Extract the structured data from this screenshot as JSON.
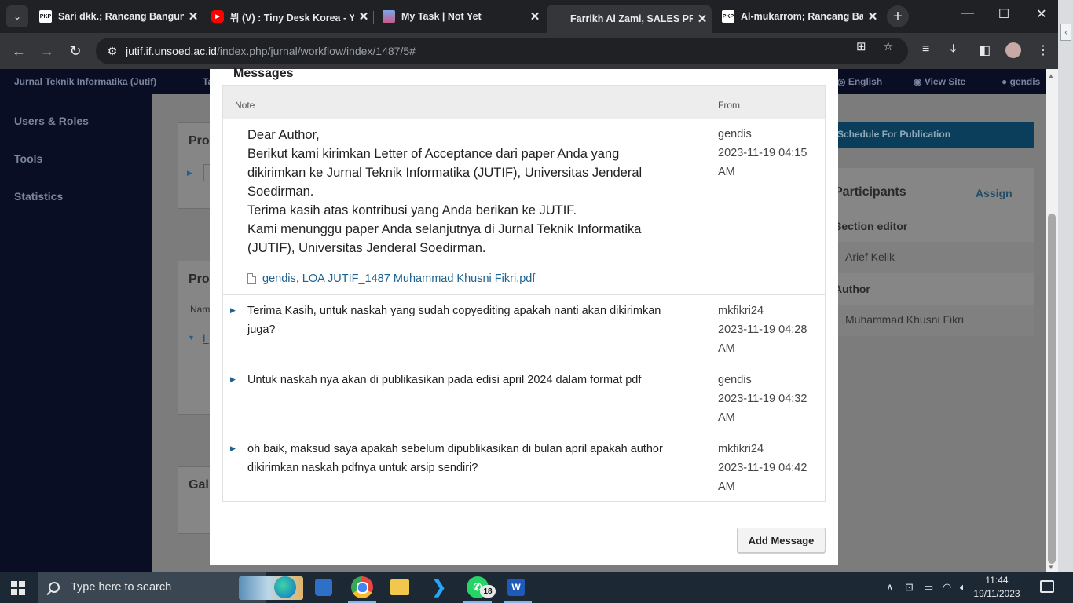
{
  "browser": {
    "tabs": [
      {
        "favicon": "PKP",
        "title": "Sari dkk.; Rancang Bangun",
        "close": "✕"
      },
      {
        "favicon": "▶",
        "title": "뷔 (V) : Tiny Desk Korea - Y",
        "close": "✕"
      },
      {
        "favicon": "",
        "title": "My Task | Not Yet",
        "close": "✕"
      },
      {
        "favicon": "",
        "title": "Farrikh Al Zami, SALES PRE",
        "close": "✕"
      },
      {
        "favicon": "PKP",
        "title": "Al-mukarrom; Rancang Ban",
        "close": "✕"
      }
    ],
    "url_host": "jutif.if.unsoed.ac.id",
    "url_path": "/index.php/jurnal/workflow/index/1487/5#"
  },
  "ojs": {
    "site_title": "Jurnal Teknik Informatika (Jutif)",
    "header_partial": "Ta",
    "language": "English",
    "view_site": "View Site",
    "user": "gendis",
    "sidebar": [
      "Users & Roles",
      "Tools",
      "Statistics"
    ],
    "panel_partials": [
      "Pro",
      "Pro",
      "Gal"
    ],
    "panel_name_partial": "Nam",
    "panel_link_partial": "L",
    "schedule_button": "Schedule For Publication",
    "participants": {
      "title": "Participants",
      "assign": "Assign",
      "groups": [
        {
          "label": "Section editor",
          "name": "Arief Kelik"
        },
        {
          "label": "Author",
          "name": "Muhammad Khusni Fikri"
        }
      ]
    }
  },
  "modal": {
    "title": "Messages",
    "col_note": "Note",
    "col_from": "From",
    "messages": [
      {
        "lines": [
          "Dear Author,",
          "Berikut kami kirimkan Letter of Acceptance dari paper Anda yang",
          "dikirimkan ke Jurnal Teknik Informatika (JUTIF), Universitas Jenderal",
          "Soedirman.",
          "Terima kasih atas kontribusi yang Anda berikan ke JUTIF.",
          "Kami menunggu paper Anda selanjutnya di Jurnal Teknik Informatika",
          "(JUTIF), Universitas Jenderal Soedirman."
        ],
        "attachment": "gendis, LOA JUTIF_1487 Muhammad Khusni Fikri.pdf",
        "from": "gendis",
        "date": "2023-11-19 04:15",
        "ampm": "AM"
      },
      {
        "text": "Terima Kasih, untuk naskah yang sudah copyediting apakah nanti akan dikirimkan juga?",
        "from": "mkfikri24",
        "date": "2023-11-19 04:28",
        "ampm": "AM"
      },
      {
        "text": "Untuk naskah nya akan di publikasikan pada edisi april 2024 dalam format pdf",
        "from": "gendis",
        "date": "2023-11-19 04:32",
        "ampm": "AM"
      },
      {
        "text": "oh baik, maksud saya apakah sebelum dipublikasikan di bulan april apakah author dikirimkan naskah pdfnya untuk arsip sendiri?",
        "from": "mkfikri24",
        "date": "2023-11-19 04:42",
        "ampm": "AM"
      }
    ],
    "add_button": "Add Message"
  },
  "taskbar": {
    "search_placeholder": "Type here to search",
    "whatsapp_badge": "18",
    "time": "11:44",
    "date": "19/11/2023"
  },
  "colors": {
    "link": "#1e6292",
    "ojs_dark": "#0a0e24",
    "taskbar": "#1c2834"
  }
}
